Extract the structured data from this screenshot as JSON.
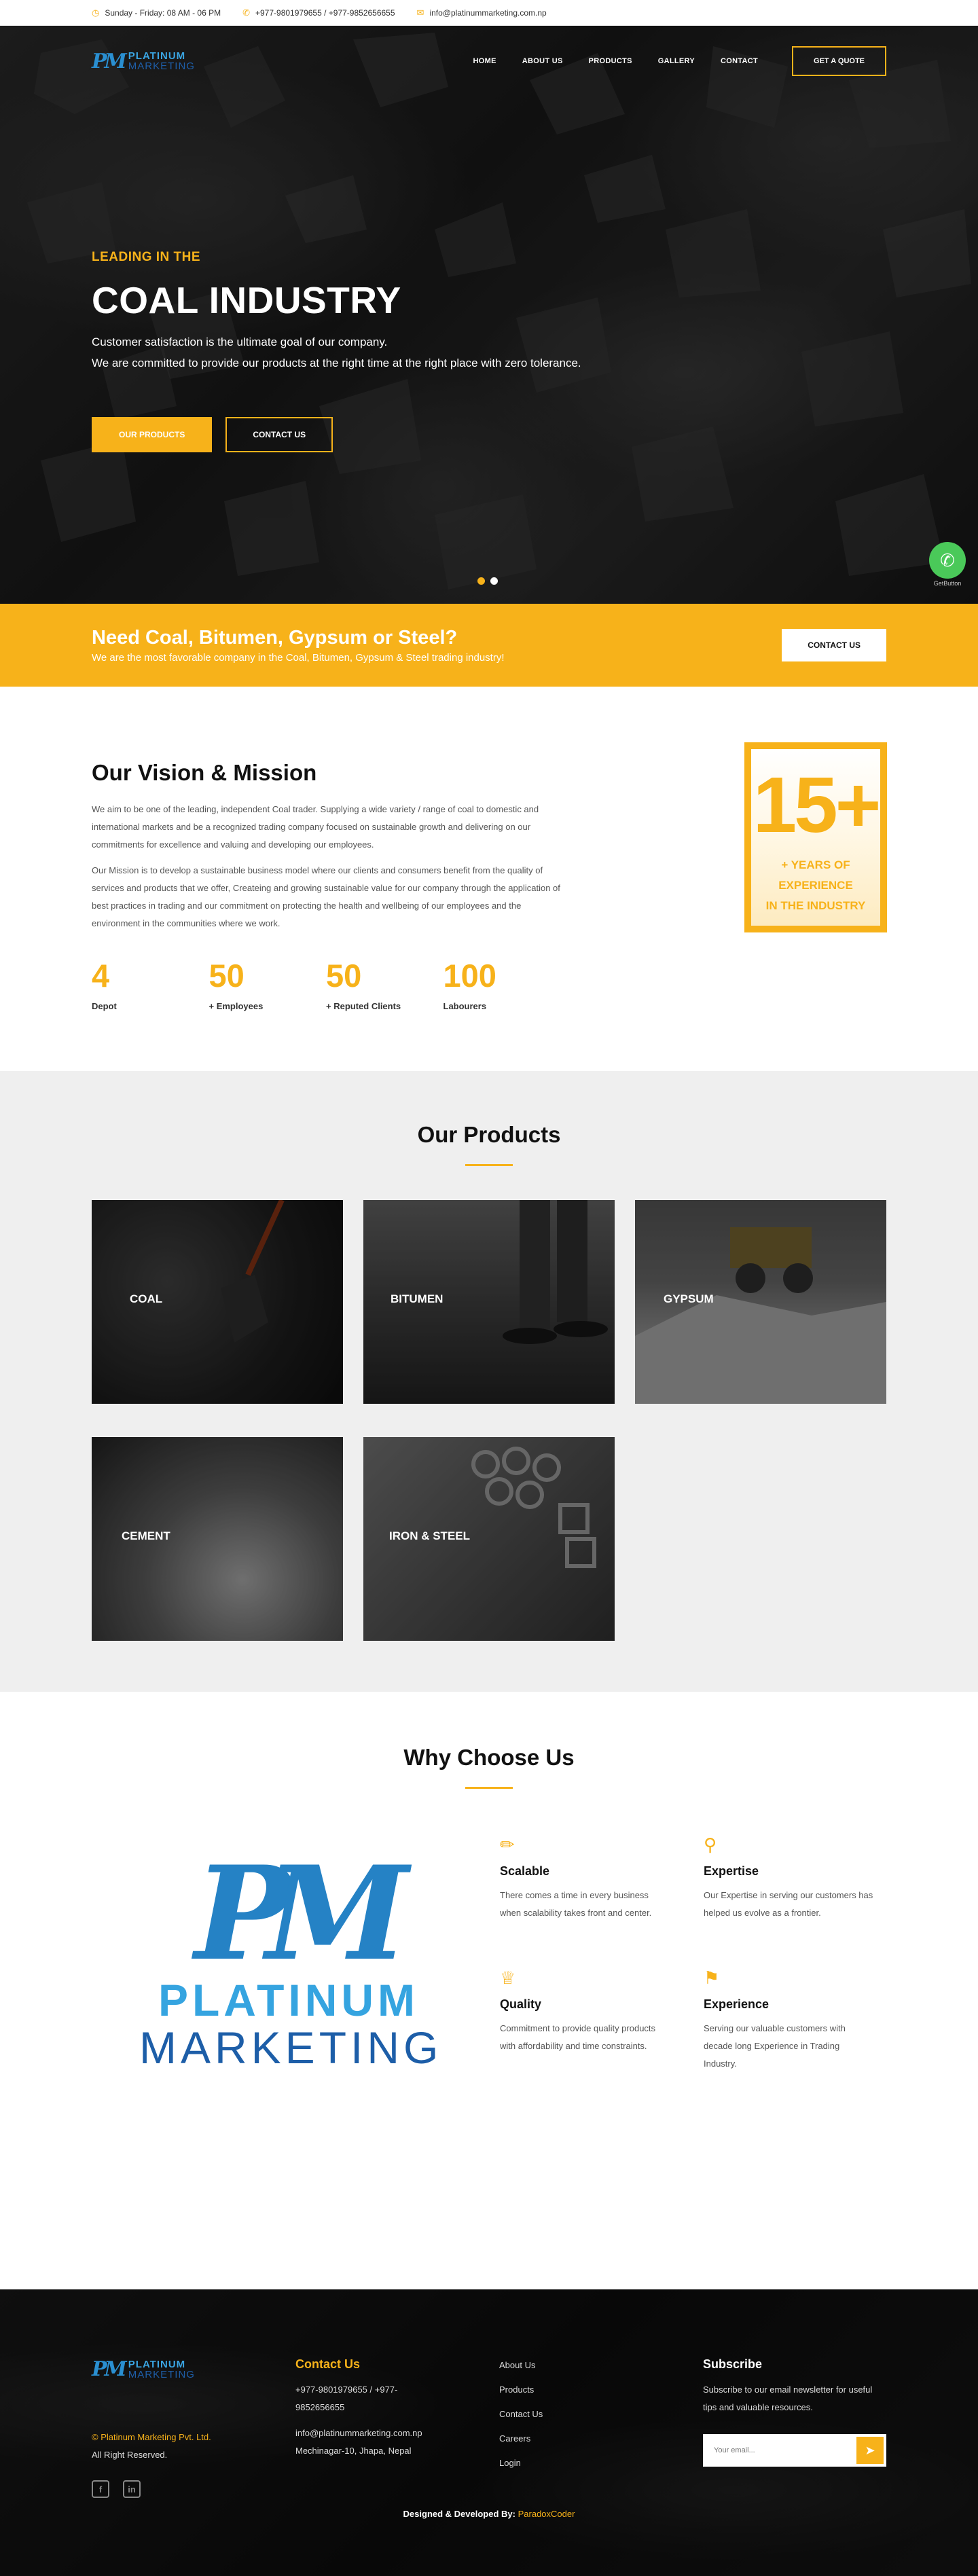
{
  "topbar": {
    "hours": "Sunday - Friday: 08 AM - 06 PM",
    "phones": "+977-9801979655 / +977-9852656655",
    "email": "info@platinummarketing.com.np"
  },
  "brand": {
    "line1": "PLATINUM",
    "line2": "MARKETING"
  },
  "nav": {
    "items": [
      "HOME",
      "ABOUT US",
      "PRODUCTS",
      "GALLERY",
      "CONTACT"
    ],
    "quote": "GET A QUOTE"
  },
  "hero": {
    "kicker": "LEADING IN THE",
    "title": "COAL INDUSTRY",
    "line1": "Customer satisfaction is the ultimate goal of our company.",
    "line2": "We are committed to provide our products at the right time at the right place with zero tolerance.",
    "btn_products": "OUR PRODUCTS",
    "btn_contact": "CONTACT US"
  },
  "whatsapp": {
    "label": "GetButton"
  },
  "cta": {
    "title": "Need Coal, Bitumen, Gypsum or Steel?",
    "subtitle": "We are the most favorable company in the Coal, Bitumen, Gypsum & Steel trading industry!",
    "button": "CONTACT US"
  },
  "vision": {
    "title": "Our Vision & Mission",
    "p1": "We aim to be one of the leading, independent Coal trader. Supplying a wide variety / range of coal to domestic and international markets and be a recognized trading company focused on sustainable growth and delivering on our commitments for excellence and valuing and developing our employees.",
    "p2": "Our Mission is to develop a sustainable business model where our clients and consumers benefit from the quality of services and products that we offer, Createing and growing sustainable value for our company through the application of best practices in trading and our commitment on protecting the health and wellbeing of our employees and the environment in the communities where we work.",
    "stats": [
      {
        "num": "4",
        "label": "Depot"
      },
      {
        "num": "50",
        "label": "+ Employees"
      },
      {
        "num": "50",
        "label": "+ Reputed Clients"
      },
      {
        "num": "100",
        "label": "Labourers"
      }
    ],
    "experience": {
      "number": "15+",
      "l1": "+ YEARS OF",
      "l2": "EXPERIENCE",
      "l3": "IN THE INDUSTRY"
    }
  },
  "products": {
    "title": "Our Products",
    "items": [
      "COAL",
      "BITUMEN",
      "GYPSUM",
      "CEMENT",
      "IRON & STEEL"
    ]
  },
  "why": {
    "title": "Why Choose Us",
    "logo_word1": "PLATINUM",
    "logo_word2": "MARKETING",
    "features": [
      {
        "icon": "ruler-icon",
        "title": "Scalable",
        "text": "There comes a time in every business when scalability takes front and center."
      },
      {
        "icon": "lightbulb-icon",
        "title": "Expertise",
        "text": "Our Expertise in serving our customers has helped us evolve as a frontier."
      },
      {
        "icon": "trophy-icon",
        "title": "Quality",
        "text": "Commitment to provide quality products with affordability and time constraints."
      },
      {
        "icon": "flag-icon",
        "title": "Experience",
        "text": "Serving our valuable customers with decade long Experience in Trading Industry."
      }
    ]
  },
  "footer": {
    "copyright": "© Platinum Marketing Pvt. Ltd.",
    "rights": "All Right Reserved.",
    "contact_title": "Contact Us",
    "phone": "+977-9801979655 / +977-9852656655",
    "email": "info@platinummarketing.com.np",
    "address": "Mechinagar-10, Jhapa, Nepal",
    "links": [
      "About Us",
      "Products",
      "Contact Us",
      "Careers",
      "Login"
    ],
    "subscribe_title": "Subscribe",
    "subscribe_text": "Subscribe to our email newsletter for useful tips and valuable resources.",
    "email_placeholder": "Your email...",
    "designed_by": "Designed & Developed By:",
    "designer": "ParadoxCoder"
  },
  "colors": {
    "accent": "#f7b21a",
    "brand_blue": "#2582c5",
    "dark": "#1a1a1a"
  }
}
